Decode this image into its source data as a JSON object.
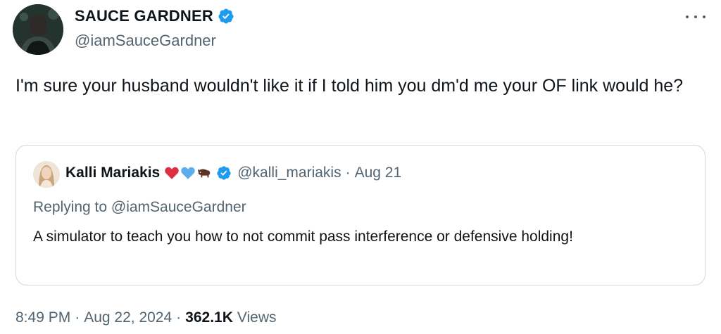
{
  "author": {
    "display_name": "SAUCE GARDNER",
    "handle": "@iamSauceGardner",
    "verified": true
  },
  "tweet": {
    "text": "I'm sure your husband wouldn't like it if I told him you dm'd me your OF link would he?"
  },
  "quoted_tweet": {
    "display_name": "Kalli Mariakis",
    "emojis": [
      "red-heart-icon",
      "blue-heart-icon",
      "bison-icon"
    ],
    "verified": true,
    "handle": "@kalli_mariakis",
    "separator": "·",
    "date": "Aug 21",
    "replying_to": "Replying to @iamSauceGardner",
    "text": "A simulator to teach you how to not commit pass interference or defensive holding!"
  },
  "meta": {
    "time": "8:49 PM",
    "separator": "·",
    "date": "Aug 22, 2024",
    "views_count": "362.1K",
    "views_label": "Views"
  },
  "colors": {
    "verified_blue": "#1d9bf0",
    "secondary_text": "#536471",
    "primary_text": "#0f1419",
    "border": "#cfd9de"
  }
}
